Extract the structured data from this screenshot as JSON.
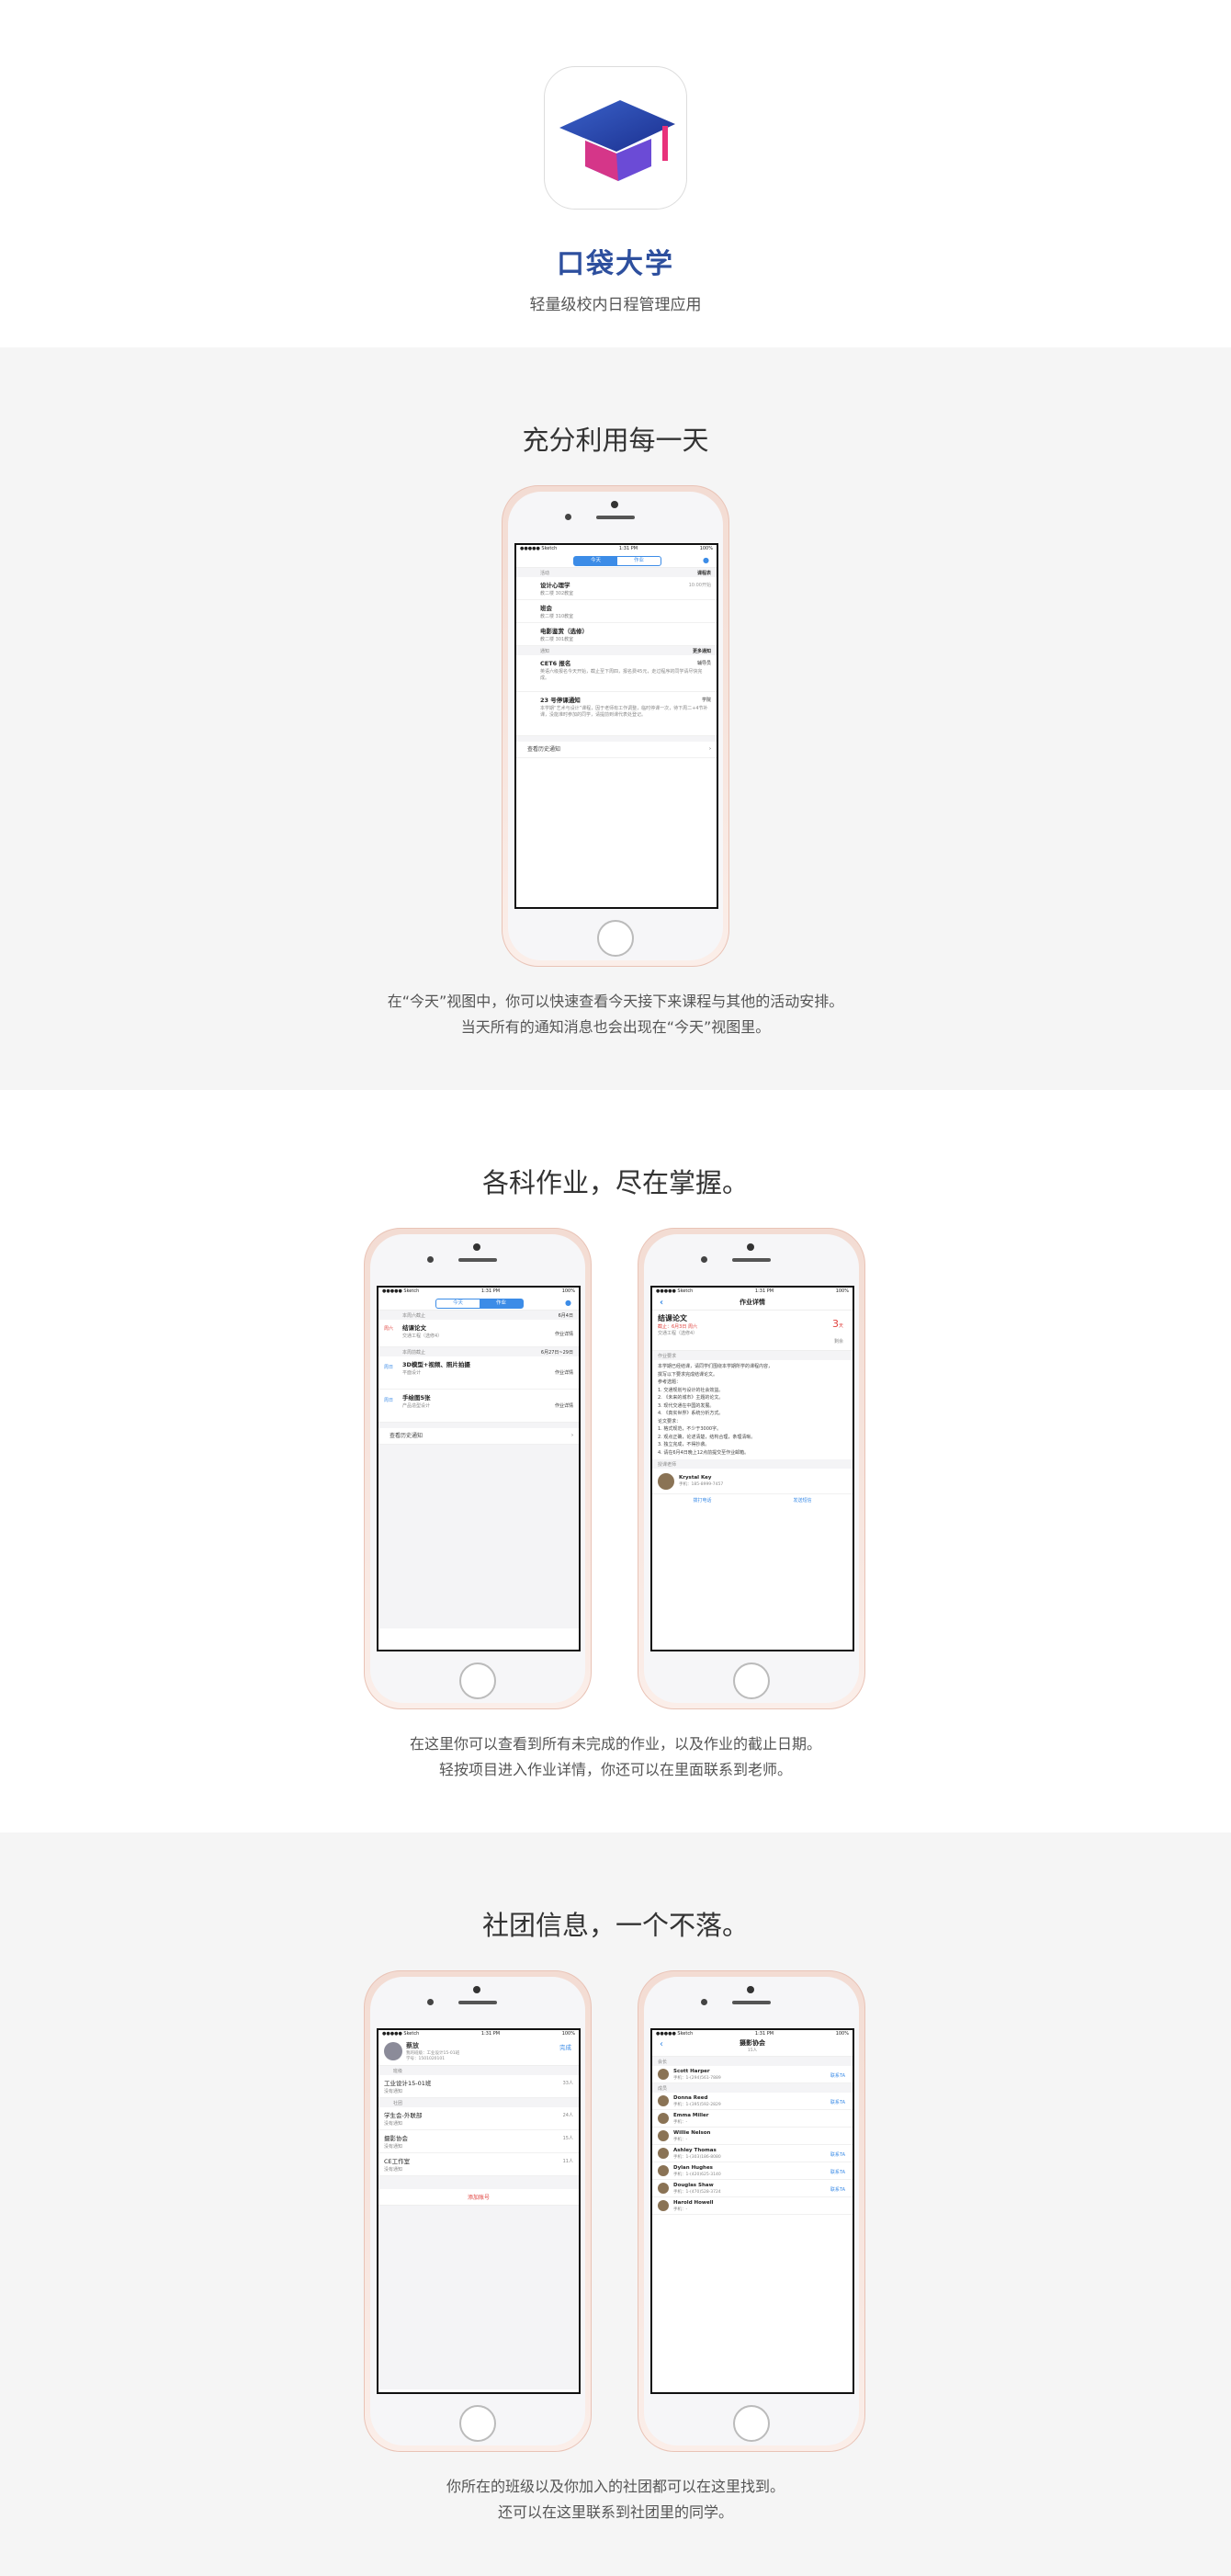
{
  "app": {
    "name": "口袋大学",
    "subtitle": "轻量级校内日程管理应用"
  },
  "colors": {
    "brand_blue": "#2d4f9e",
    "accent": "#3c8ce7",
    "section_bg": "#f5f5f5",
    "urgent": "#e0413d"
  },
  "sections": [
    {
      "title": "充分利用每一天",
      "desc": [
        "在“今天”视图中，你可以快速查看今天接下来课程与其他的活动安排。",
        "当天所有的通知消息也会出现在“今天”视图里。"
      ]
    },
    {
      "title": "各科作业，尽在掌握。",
      "desc": [
        "在这里你可以查看到所有未完成的作业，以及作业的截止日期。",
        "轻按项目进入作业详情，你还可以在里面联系到老师。"
      ]
    },
    {
      "title": "社团信息，一个不落。",
      "desc": [
        "你所在的班级以及你加入的社团都可以在这里找到。",
        "还可以在这里联系到社团里的同学。"
      ]
    }
  ],
  "status": {
    "carrier": "●●●●● Sketch",
    "time": "1:31 PM",
    "battery": "100%"
  },
  "today": {
    "tabs": [
      "今天",
      "作业"
    ],
    "schedule_label": "活动",
    "schedule_more": "课程表",
    "classes": [
      {
        "name": "设计心理学",
        "place": "教二楼 302教室",
        "time": "10:00开始"
      },
      {
        "name": "班会",
        "place": "教二楼 310教室",
        "time": ""
      },
      {
        "name": "电影鉴赏（选修）",
        "place": "教二楼 301教室",
        "time": ""
      }
    ],
    "notice_label": "通知",
    "notice_more": "更多通知",
    "notices": [
      {
        "title": "CET6 报名",
        "from": "辅导员",
        "body": "英语六级报名今天开始，截止至下周四，报名费45元，走过程序的同学请尽快完成。"
      },
      {
        "title": "23 号停课通知",
        "from": "学院",
        "body": "本学期“艺术与设计”课程，因于老师有工作调整，临时停课一次，待下周二+4节补课，没能准时参加的同学，请提前到课代表处登记。"
      }
    ],
    "history": "查看历史通知"
  },
  "homework": {
    "tabs": [
      "今天",
      "作业"
    ],
    "groups": [
      {
        "label": "本周六截止",
        "date": "6月4日",
        "items": [
          {
            "tag": "周六",
            "title": "结课论文",
            "sub": "交通工程（选修4）",
            "action": "作业详情"
          }
        ]
      },
      {
        "label": "本周前截止",
        "date": "6月27日~29日",
        "items": [
          {
            "tag": "周日",
            "title": "3D模型+视频、照片拍摄",
            "sub": "平面设计",
            "action": "作业详情"
          },
          {
            "tag": "周日",
            "title": "手绘图5张",
            "sub": "产品造型设计",
            "action": "作业详情"
          }
        ]
      }
    ],
    "history": "查看历史通知"
  },
  "detail": {
    "nav_title": "作业详情",
    "title": "结课论文",
    "meta": "截止：6月3日 周六",
    "course": "交通工程（选修4）",
    "days": "3",
    "days_unit": "天",
    "days_label": "剩余",
    "req_label": "作业要求",
    "lines": [
      "本学期已经结课，请同学们围绕本学期所学的课程内容，",
      "撰写以下要求完成结课论文。",
      "参考选题：",
      "1. 交通规划与设计的社会效益。",
      "2. 《未来的城市》主题的论文。",
      "3. 现代交通在中国的发展。",
      "4. 《真实世界》系统分析方式。",
      "论文要求：",
      "1. 格式规范，不少于3000字。",
      "2. 观点正确，论述清楚，结构合理，条理清晰。",
      "3. 独立完成，不得抄袭。",
      "4. 请在6月4日晚上12点前提交至作业邮箱。"
    ],
    "teacher_label": "授课老师",
    "teacher": "Krystal Key",
    "phone": "手机：185-8999-7457",
    "call": "拨打电话",
    "sms": "发送短信"
  },
  "me": {
    "name": "蔡放",
    "info": "我的班级：工业设计15-01班",
    "id": "学号：1501020101",
    "done": "完成",
    "class_label": "班级",
    "class": {
      "name": "工业设计15-01班",
      "sub": "没有通知",
      "count": "33人"
    },
    "club_label": "社团",
    "clubs": [
      {
        "name": "学生会-外联部",
        "sub": "没有通知",
        "count": "24人"
      },
      {
        "name": "摄影协会",
        "sub": "没有通知",
        "count": "15人"
      },
      {
        "name": "CE工作室",
        "sub": "没有通知",
        "count": "11人"
      }
    ],
    "add": "添加账号"
  },
  "club": {
    "title": "摄影协会",
    "subtitle": "15人",
    "sec1": "会长",
    "sec2": "成员",
    "leaders": [
      {
        "name": "Scott Harper",
        "phone": "手机：1-(294)561-7889",
        "action": "联系TA"
      }
    ],
    "members": [
      {
        "name": "Donna Reed",
        "phone": "手机：1-(395)592-2829",
        "action": "联系TA"
      },
      {
        "name": "Emma Miller",
        "phone": "手机：-",
        "action": ""
      },
      {
        "name": "Willie Nelson",
        "phone": "手机：-",
        "action": ""
      },
      {
        "name": "Ashley Thomas",
        "phone": "手机：1-(303)186-8080",
        "action": "联系TA"
      },
      {
        "name": "Dylan Hughes",
        "phone": "手机：1-(420)625-3140",
        "action": "联系TA"
      },
      {
        "name": "Douglas Shaw",
        "phone": "手机：1-(470)528-3724",
        "action": "联系TA"
      },
      {
        "name": "Harold Howell",
        "phone": "手机：-",
        "action": ""
      }
    ]
  }
}
